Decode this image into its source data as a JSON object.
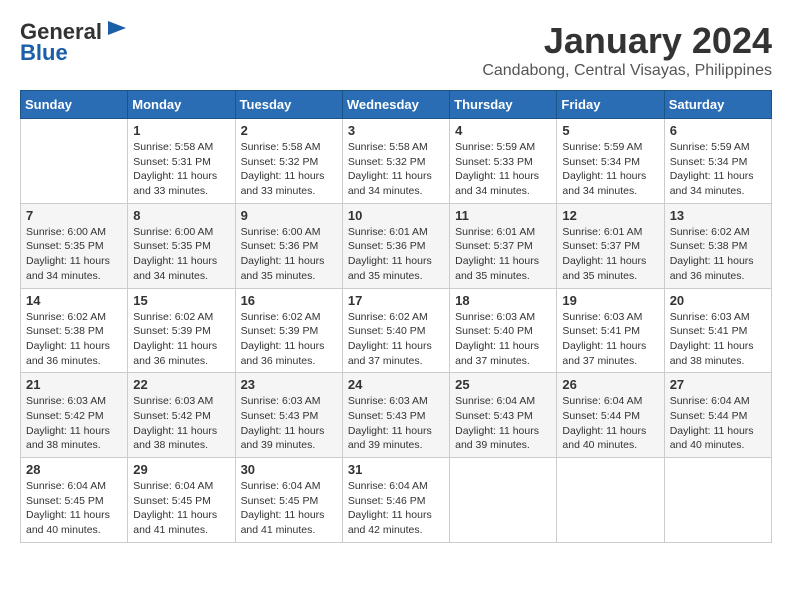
{
  "header": {
    "logo_line1": "General",
    "logo_line2": "Blue",
    "month": "January 2024",
    "location": "Candabong, Central Visayas, Philippines"
  },
  "weekdays": [
    "Sunday",
    "Monday",
    "Tuesday",
    "Wednesday",
    "Thursday",
    "Friday",
    "Saturday"
  ],
  "weeks": [
    [
      {
        "day": "",
        "info": ""
      },
      {
        "day": "1",
        "info": "Sunrise: 5:58 AM\nSunset: 5:31 PM\nDaylight: 11 hours\nand 33 minutes."
      },
      {
        "day": "2",
        "info": "Sunrise: 5:58 AM\nSunset: 5:32 PM\nDaylight: 11 hours\nand 33 minutes."
      },
      {
        "day": "3",
        "info": "Sunrise: 5:58 AM\nSunset: 5:32 PM\nDaylight: 11 hours\nand 34 minutes."
      },
      {
        "day": "4",
        "info": "Sunrise: 5:59 AM\nSunset: 5:33 PM\nDaylight: 11 hours\nand 34 minutes."
      },
      {
        "day": "5",
        "info": "Sunrise: 5:59 AM\nSunset: 5:34 PM\nDaylight: 11 hours\nand 34 minutes."
      },
      {
        "day": "6",
        "info": "Sunrise: 5:59 AM\nSunset: 5:34 PM\nDaylight: 11 hours\nand 34 minutes."
      }
    ],
    [
      {
        "day": "7",
        "info": "Sunrise: 6:00 AM\nSunset: 5:35 PM\nDaylight: 11 hours\nand 34 minutes."
      },
      {
        "day": "8",
        "info": "Sunrise: 6:00 AM\nSunset: 5:35 PM\nDaylight: 11 hours\nand 34 minutes."
      },
      {
        "day": "9",
        "info": "Sunrise: 6:00 AM\nSunset: 5:36 PM\nDaylight: 11 hours\nand 35 minutes."
      },
      {
        "day": "10",
        "info": "Sunrise: 6:01 AM\nSunset: 5:36 PM\nDaylight: 11 hours\nand 35 minutes."
      },
      {
        "day": "11",
        "info": "Sunrise: 6:01 AM\nSunset: 5:37 PM\nDaylight: 11 hours\nand 35 minutes."
      },
      {
        "day": "12",
        "info": "Sunrise: 6:01 AM\nSunset: 5:37 PM\nDaylight: 11 hours\nand 35 minutes."
      },
      {
        "day": "13",
        "info": "Sunrise: 6:02 AM\nSunset: 5:38 PM\nDaylight: 11 hours\nand 36 minutes."
      }
    ],
    [
      {
        "day": "14",
        "info": "Sunrise: 6:02 AM\nSunset: 5:38 PM\nDaylight: 11 hours\nand 36 minutes."
      },
      {
        "day": "15",
        "info": "Sunrise: 6:02 AM\nSunset: 5:39 PM\nDaylight: 11 hours\nand 36 minutes."
      },
      {
        "day": "16",
        "info": "Sunrise: 6:02 AM\nSunset: 5:39 PM\nDaylight: 11 hours\nand 36 minutes."
      },
      {
        "day": "17",
        "info": "Sunrise: 6:02 AM\nSunset: 5:40 PM\nDaylight: 11 hours\nand 37 minutes."
      },
      {
        "day": "18",
        "info": "Sunrise: 6:03 AM\nSunset: 5:40 PM\nDaylight: 11 hours\nand 37 minutes."
      },
      {
        "day": "19",
        "info": "Sunrise: 6:03 AM\nSunset: 5:41 PM\nDaylight: 11 hours\nand 37 minutes."
      },
      {
        "day": "20",
        "info": "Sunrise: 6:03 AM\nSunset: 5:41 PM\nDaylight: 11 hours\nand 38 minutes."
      }
    ],
    [
      {
        "day": "21",
        "info": "Sunrise: 6:03 AM\nSunset: 5:42 PM\nDaylight: 11 hours\nand 38 minutes."
      },
      {
        "day": "22",
        "info": "Sunrise: 6:03 AM\nSunset: 5:42 PM\nDaylight: 11 hours\nand 38 minutes."
      },
      {
        "day": "23",
        "info": "Sunrise: 6:03 AM\nSunset: 5:43 PM\nDaylight: 11 hours\nand 39 minutes."
      },
      {
        "day": "24",
        "info": "Sunrise: 6:03 AM\nSunset: 5:43 PM\nDaylight: 11 hours\nand 39 minutes."
      },
      {
        "day": "25",
        "info": "Sunrise: 6:04 AM\nSunset: 5:43 PM\nDaylight: 11 hours\nand 39 minutes."
      },
      {
        "day": "26",
        "info": "Sunrise: 6:04 AM\nSunset: 5:44 PM\nDaylight: 11 hours\nand 40 minutes."
      },
      {
        "day": "27",
        "info": "Sunrise: 6:04 AM\nSunset: 5:44 PM\nDaylight: 11 hours\nand 40 minutes."
      }
    ],
    [
      {
        "day": "28",
        "info": "Sunrise: 6:04 AM\nSunset: 5:45 PM\nDaylight: 11 hours\nand 40 minutes."
      },
      {
        "day": "29",
        "info": "Sunrise: 6:04 AM\nSunset: 5:45 PM\nDaylight: 11 hours\nand 41 minutes."
      },
      {
        "day": "30",
        "info": "Sunrise: 6:04 AM\nSunset: 5:45 PM\nDaylight: 11 hours\nand 41 minutes."
      },
      {
        "day": "31",
        "info": "Sunrise: 6:04 AM\nSunset: 5:46 PM\nDaylight: 11 hours\nand 42 minutes."
      },
      {
        "day": "",
        "info": ""
      },
      {
        "day": "",
        "info": ""
      },
      {
        "day": "",
        "info": ""
      }
    ]
  ]
}
